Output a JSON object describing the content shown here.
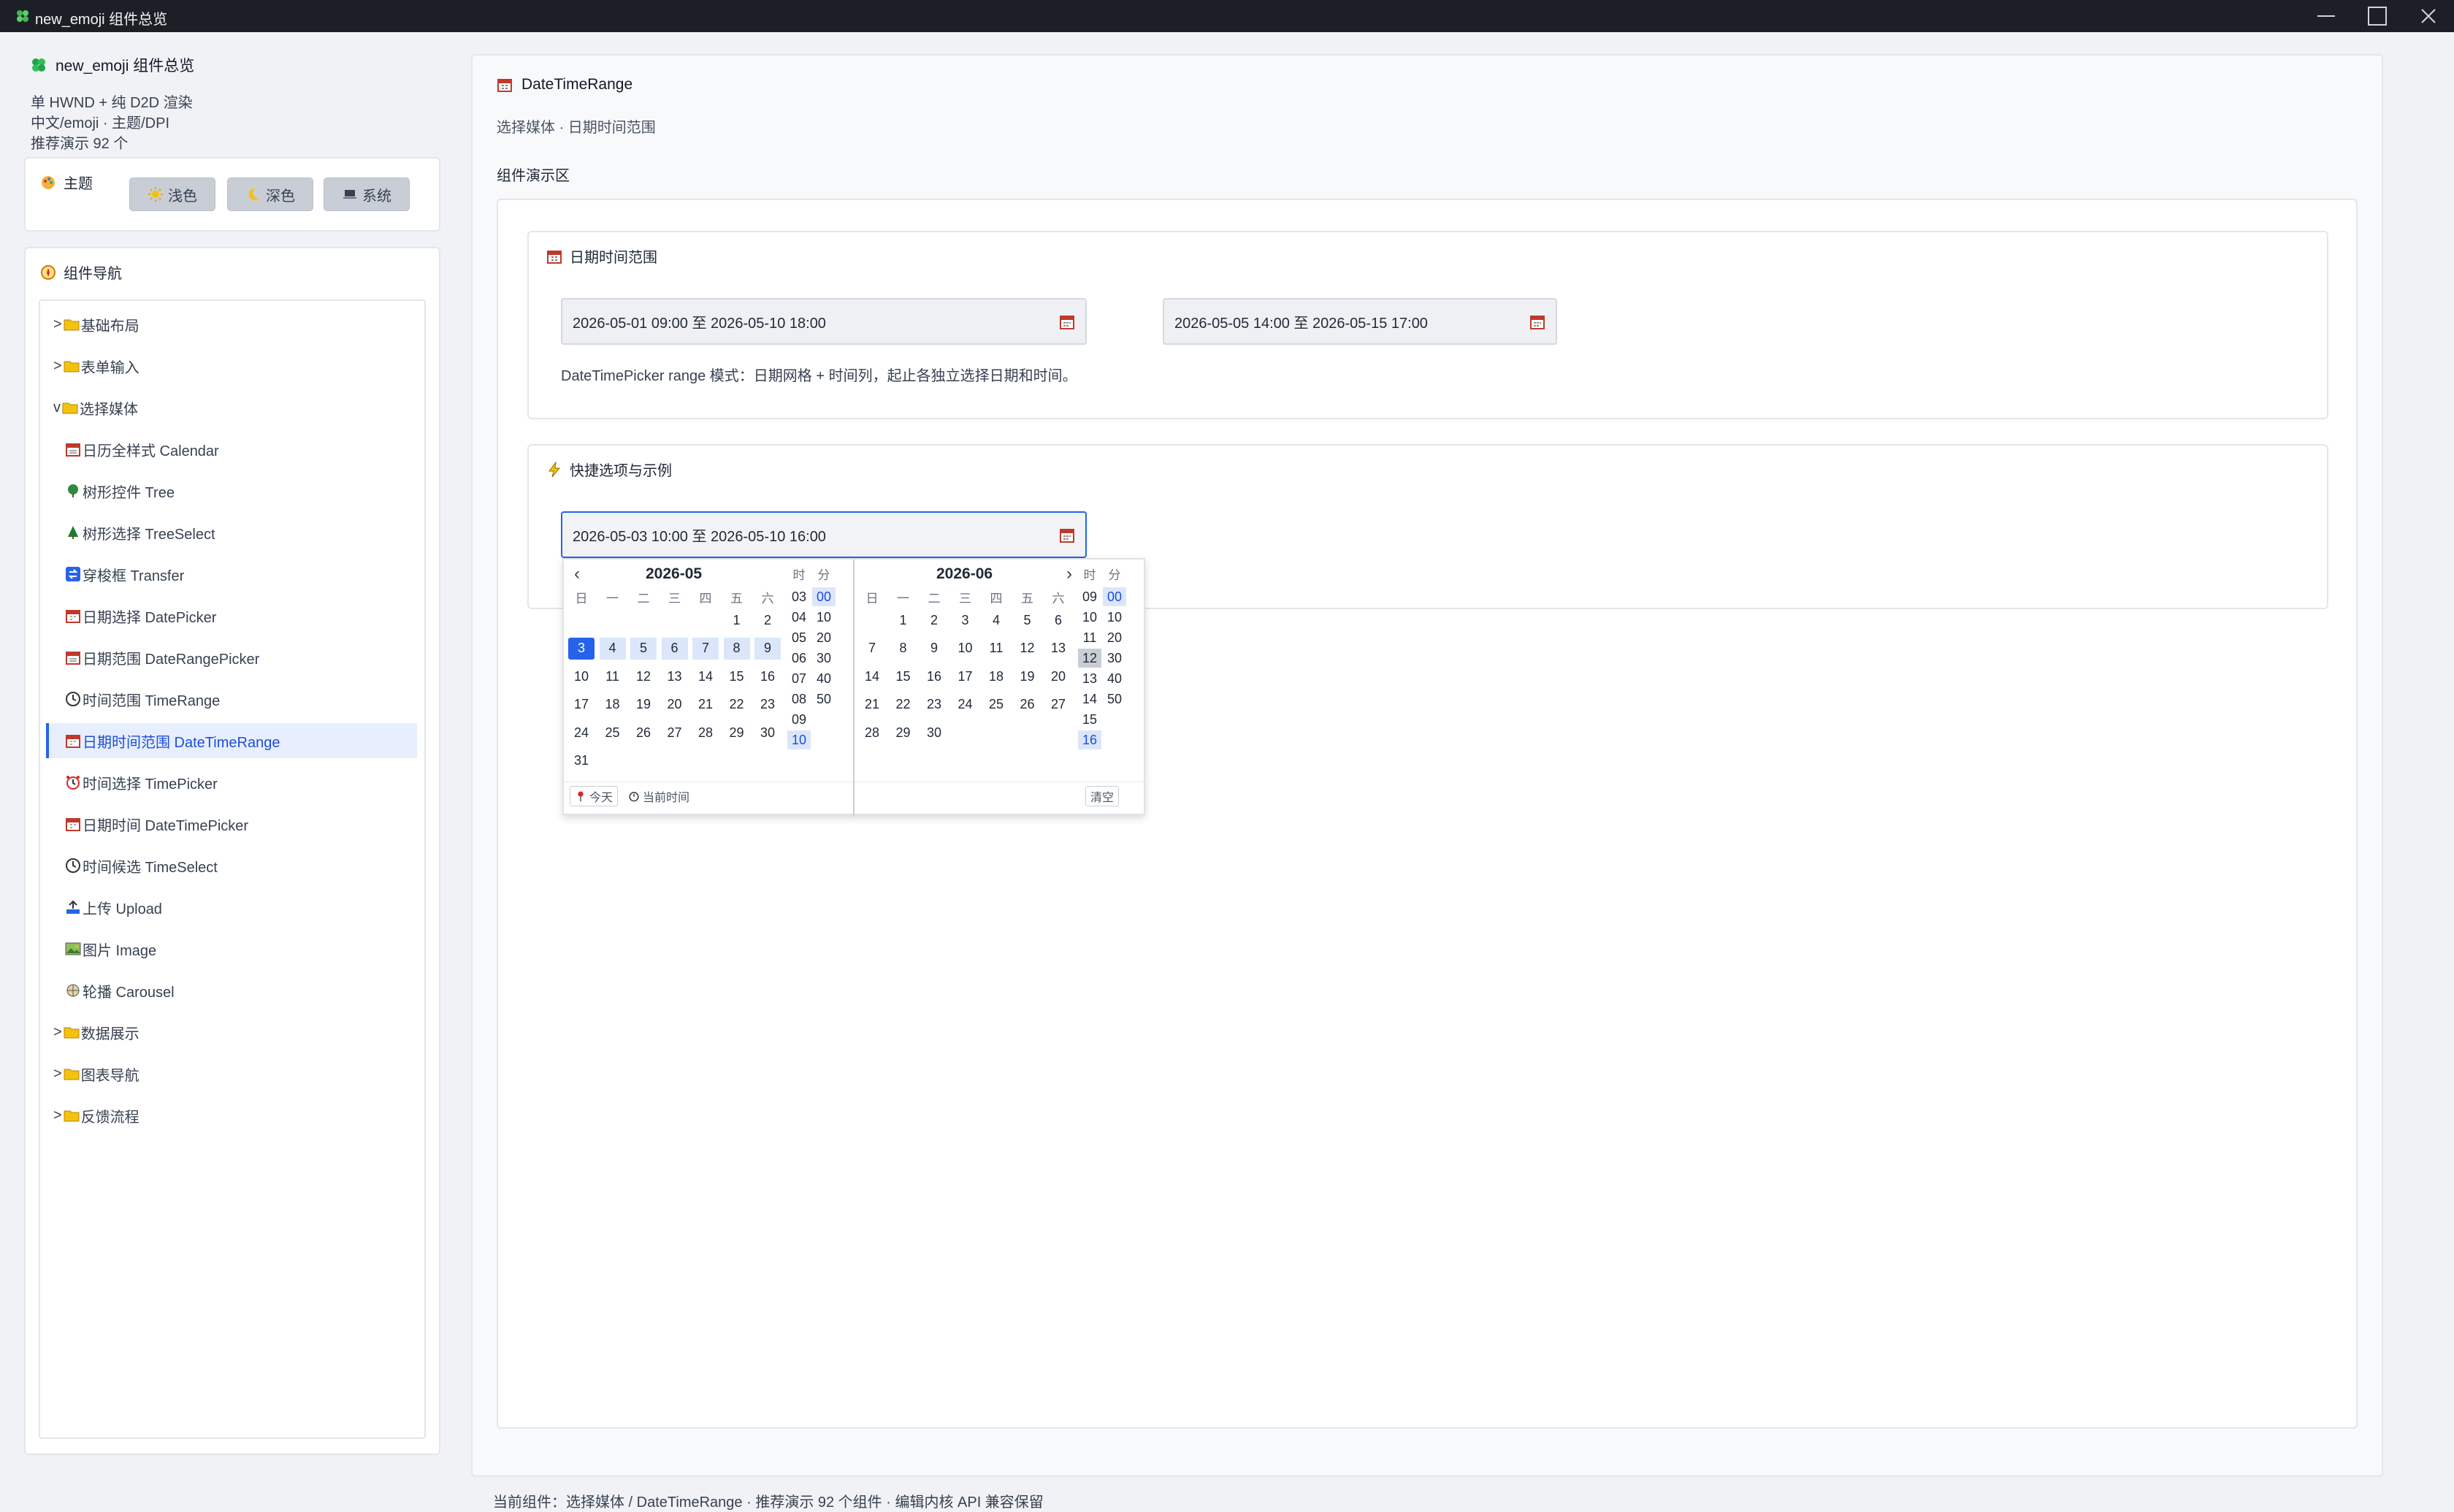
{
  "window": {
    "title": "new_emoji 组件总览"
  },
  "sidebar": {
    "title": "new_emoji 组件总览",
    "info_lines": [
      "单 HWND + 纯 D2D 渲染",
      "中文/emoji · 主题/DPI",
      "推荐演示 92 个"
    ],
    "theme": {
      "header": "主题",
      "buttons": [
        {
          "label": "浅色",
          "icon": "sun-icon"
        },
        {
          "label": "深色",
          "icon": "moon-icon"
        },
        {
          "label": "系统",
          "icon": "laptop-icon"
        }
      ]
    },
    "nav": {
      "header": "组件导航",
      "items": [
        {
          "label": ">📁基础布局",
          "text": "基础布局",
          "prefix": ">"
        },
        {
          "label": "表单输入",
          "prefix": ">"
        },
        {
          "label": "选择媒体",
          "prefix": "v"
        },
        {
          "label": "日历全样式 Calendar"
        },
        {
          "label": "树形控件 Tree"
        },
        {
          "label": "树形选择 TreeSelect"
        },
        {
          "label": "穿梭框 Transfer"
        },
        {
          "label": "日期选择 DatePicker"
        },
        {
          "label": "日期范围 DateRangePicker"
        },
        {
          "label": "时间范围 TimeRange"
        },
        {
          "label": "日期时间范围 DateTimeRange"
        },
        {
          "label": "时间选择 TimePicker"
        },
        {
          "label": "日期时间 DateTimePicker"
        },
        {
          "label": "时间候选 TimeSelect"
        },
        {
          "label": "上传 Upload"
        },
        {
          "label": "图片 Image"
        },
        {
          "label": "轮播 Carousel"
        },
        {
          "label": "数据展示",
          "prefix": ">"
        },
        {
          "label": "图表导航",
          "prefix": ">"
        },
        {
          "label": "反馈流程",
          "prefix": ">"
        }
      ]
    }
  },
  "main": {
    "title": "DateTimeRange",
    "subtitle": "选择媒体 · 日期时间范围",
    "demo_label": "组件演示区",
    "section1": {
      "header": "日期时间范围",
      "input1": "2026-05-01 09:00 至 2026-05-10 18:00",
      "input2": "2026-05-05 14:00 至 2026-05-15 17:00",
      "note": "DateTimePicker range 模式：日期网格 + 时间列，起止各独立选择日期和时间。"
    },
    "section2": {
      "header": "快捷选项与示例",
      "input": "2026-05-03 10:00 至 2026-05-10 16:00"
    }
  },
  "popup": {
    "left": {
      "month": "2026-05",
      "prev": "‹",
      "weekdays": [
        "日",
        "一",
        "二",
        "三",
        "四",
        "五",
        "六"
      ],
      "hour_label": "时",
      "min_label": "分",
      "hours": [
        "03",
        "04",
        "05",
        "06",
        "07",
        "08",
        "09",
        "10"
      ],
      "minutes": [
        "00",
        "10",
        "20",
        "30",
        "40",
        "50"
      ],
      "selected_day": "3",
      "selected_hour": "10",
      "selected_minute": "00",
      "footer": {
        "today": "今天",
        "now": "当前时间"
      }
    },
    "right": {
      "month": "2026-06",
      "next": "›",
      "weekdays": [
        "日",
        "一",
        "二",
        "三",
        "四",
        "五",
        "六"
      ],
      "hour_label": "时",
      "min_label": "分",
      "hours": [
        "09",
        "10",
        "11",
        "12",
        "13",
        "14",
        "15",
        "16"
      ],
      "minutes": [
        "00",
        "10",
        "20",
        "30",
        "40",
        "50"
      ],
      "selected_hour": "16",
      "selected_minute": "00",
      "footer": {
        "clear": "清空"
      }
    }
  },
  "status": "当前组件：选择媒体 / DateTimeRange · 推荐演示 92 个组件 · 编辑内核 API 兼容保留"
}
